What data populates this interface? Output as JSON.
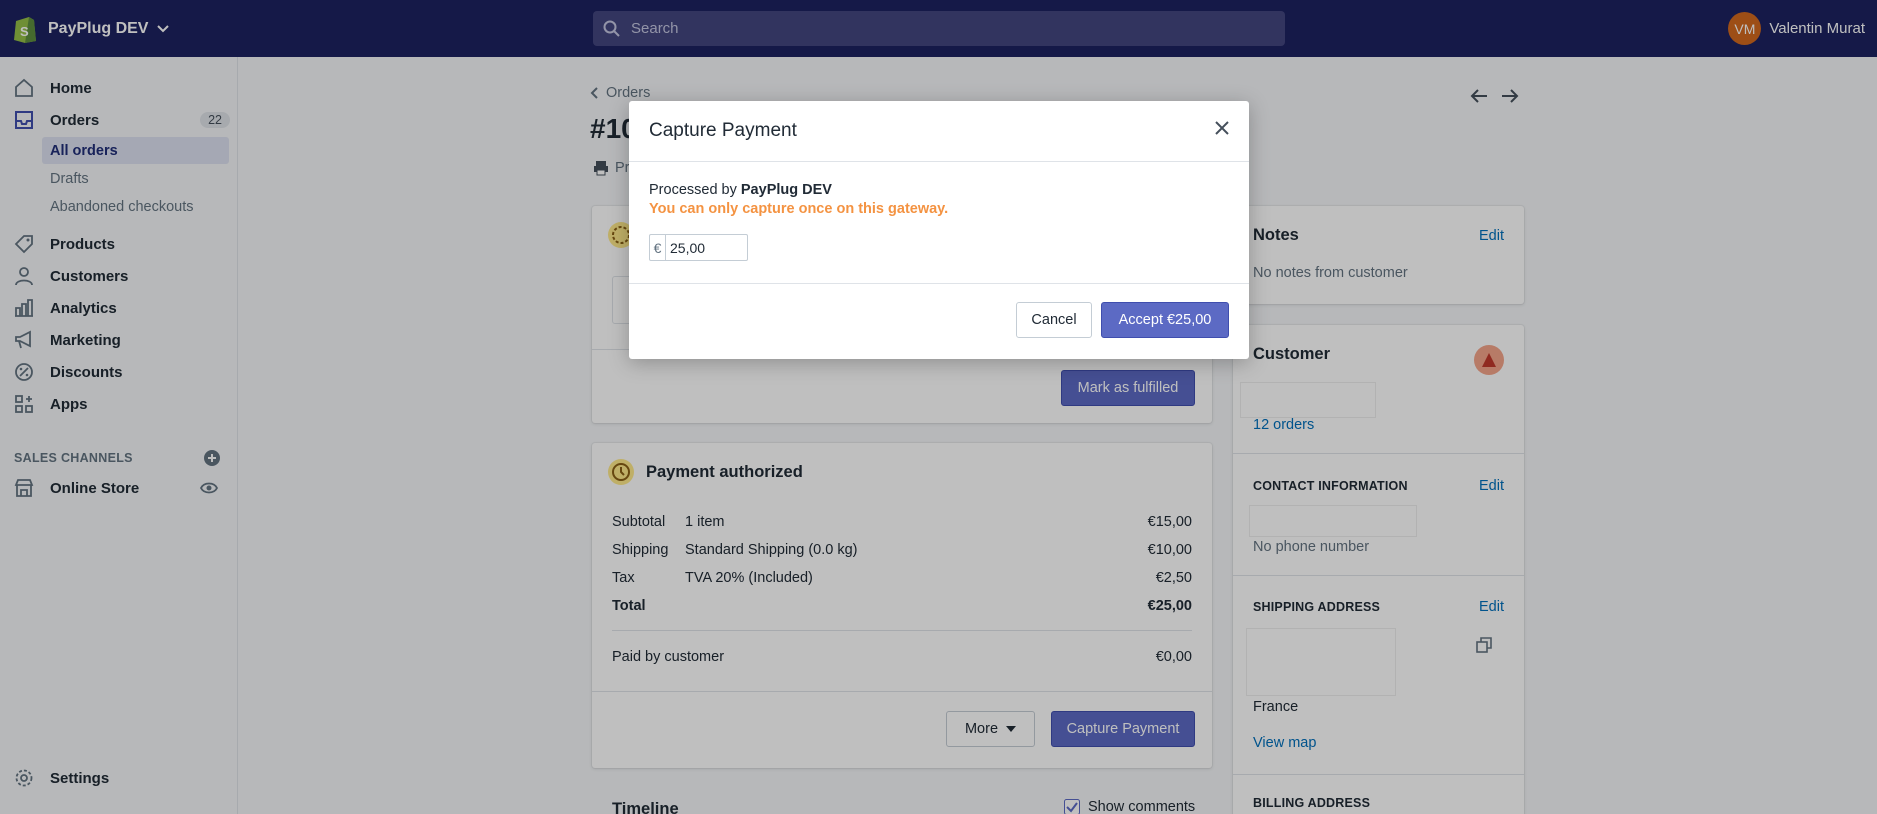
{
  "topbar": {
    "store_name": "PayPlug DEV",
    "search_placeholder": "Search",
    "user_initials": "VM",
    "user_name": "Valentin Murat"
  },
  "sidebar": {
    "home": "Home",
    "orders": "Orders",
    "orders_count": "22",
    "all_orders": "All orders",
    "drafts": "Drafts",
    "abandoned": "Abandoned checkouts",
    "products": "Products",
    "customers": "Customers",
    "analytics": "Analytics",
    "marketing": "Marketing",
    "discounts": "Discounts",
    "apps": "Apps",
    "sales_channels": "SALES CHANNELS",
    "online_store": "Online Store",
    "settings": "Settings"
  },
  "order": {
    "breadcrumb": "Orders",
    "title_fragment": "#10",
    "print_fragment": "Pr"
  },
  "fulfill": {
    "mark_fulfilled": "Mark as fulfilled"
  },
  "payment": {
    "title": "Payment authorized",
    "rows": [
      {
        "label": "Subtotal",
        "desc": "1 item",
        "amount": "€15,00"
      },
      {
        "label": "Shipping",
        "desc": "Standard Shipping (0.0 kg)",
        "amount": "€10,00"
      },
      {
        "label": "Tax",
        "desc": "TVA 20% (Included)",
        "amount": "€2,50"
      }
    ],
    "total_label": "Total",
    "total_amount": "€25,00",
    "paid_label": "Paid by customer",
    "paid_amount": "€0,00",
    "more_label": "More",
    "capture_label": "Capture Payment"
  },
  "timeline": {
    "title": "Timeline",
    "show_comments": "Show comments"
  },
  "notes": {
    "title": "Notes",
    "edit": "Edit",
    "empty": "No notes from customer"
  },
  "customer": {
    "title": "Customer",
    "orders_link": "12 orders",
    "contact_title": "CONTACT INFORMATION",
    "contact_edit": "Edit",
    "no_phone": "No phone number",
    "shipping_title": "SHIPPING ADDRESS",
    "shipping_edit": "Edit",
    "country": "France",
    "view_map": "View map",
    "billing_title": "BILLING ADDRESS"
  },
  "modal": {
    "title": "Capture Payment",
    "processed_prefix": "Processed by",
    "gateway": "PayPlug DEV",
    "warning": "You can only capture once on this gateway.",
    "currency_symbol": "€",
    "amount": "25,00",
    "cancel": "Cancel",
    "accept": "Accept €25,00"
  },
  "colors": {
    "topbar": "#1c2260",
    "primary": "#5c6ac4",
    "warning": "#f49342",
    "link": "#006fbb"
  }
}
